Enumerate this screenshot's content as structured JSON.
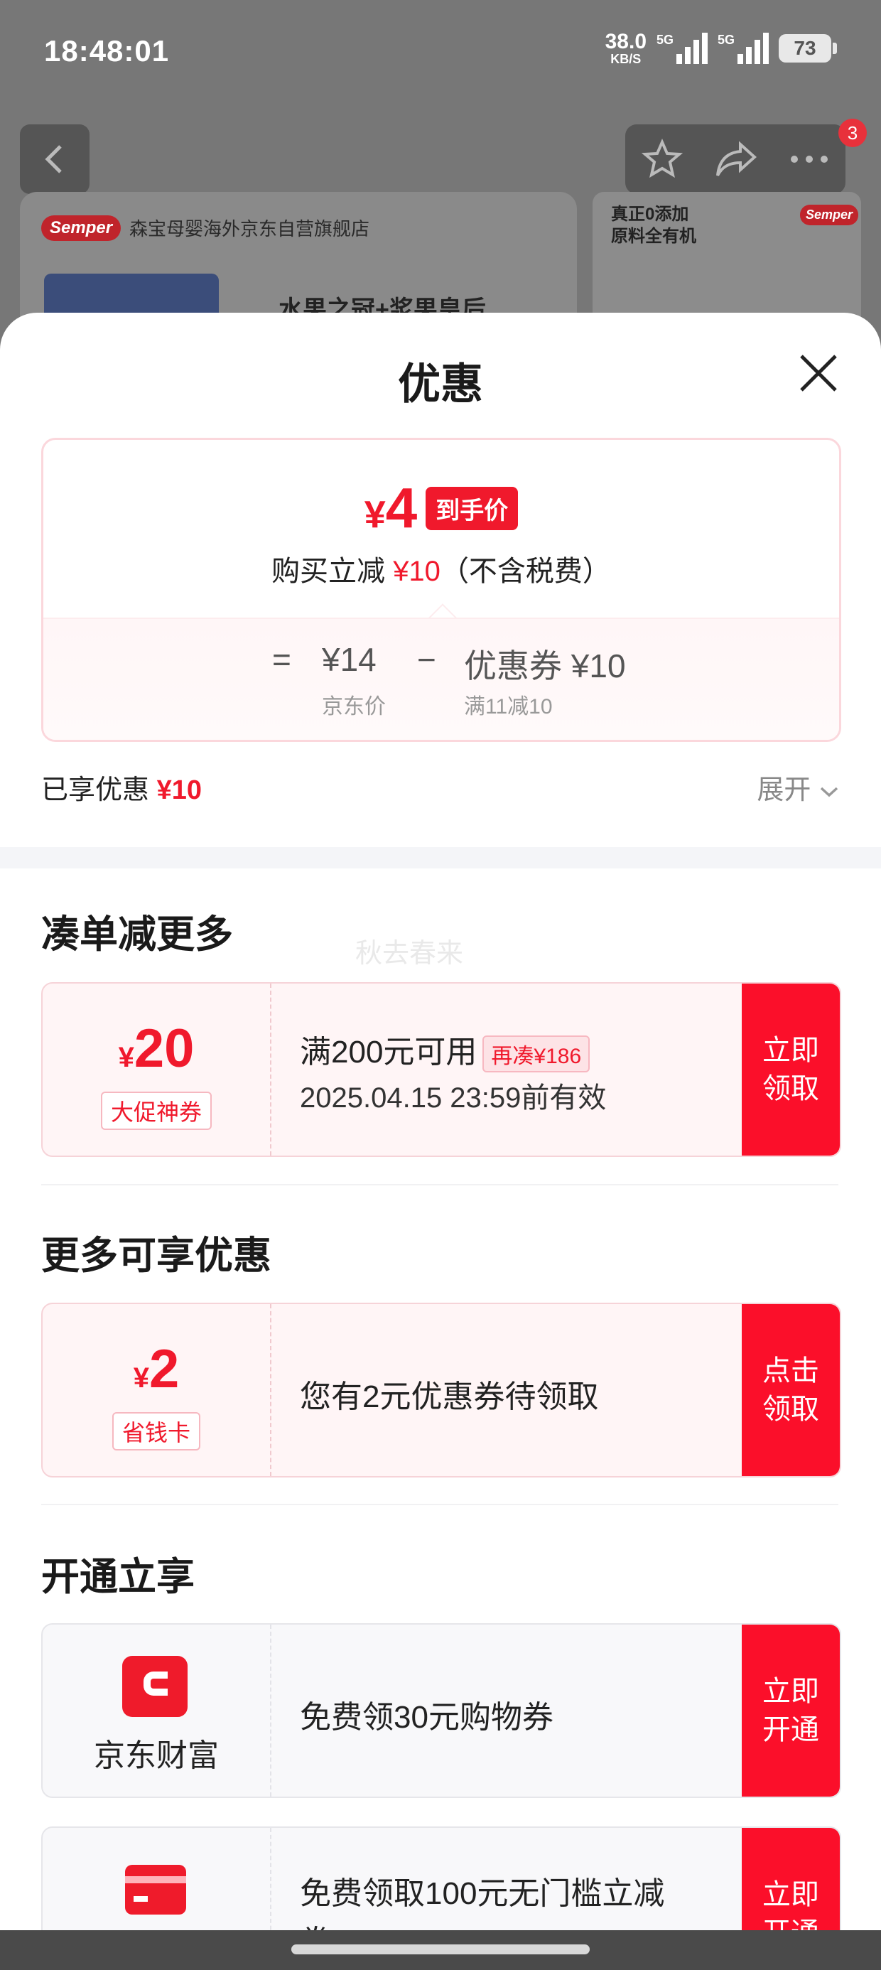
{
  "status_bar": {
    "time": "18:48:01",
    "net_speed": "38.0",
    "net_unit": "KB/S",
    "signal1_label": "5G",
    "signal2_label": "5G",
    "battery": "73"
  },
  "background": {
    "store_logo": "Semper",
    "store_name": "森宝母婴海外京东自营旗舰店",
    "headline": "水果之冠+浆果皇后",
    "side_text": "真正0添加\n原料全有机",
    "side_logo": "Semper",
    "cart_badge": "3"
  },
  "sheet": {
    "title": "优惠",
    "summary": {
      "currency": "¥",
      "final_price": "4",
      "final_tag": "到手价",
      "reduce_prefix": "购买立减",
      "reduce_amount": "¥10",
      "reduce_suffix": "（不含税费）",
      "eq": "=",
      "jd_price": "¥14",
      "jd_price_label": "京东价",
      "minus": "−",
      "coupon_label": "优惠券 ¥10",
      "coupon_rule": "满11减10"
    },
    "enjoyed_label": "已享优惠",
    "enjoyed_amount": "¥10",
    "expand_label": "展开",
    "section_more": "凑单减更多",
    "watermark": "秋去春来",
    "coupon1": {
      "currency": "¥",
      "amount": "20",
      "type": "大促神券",
      "condition": "满200元可用",
      "addon": "再凑¥186",
      "expiry": "2025.04.15 23:59前有效",
      "action_line1": "立即",
      "action_line2": "领取"
    },
    "section_enjoy": "更多可享优惠",
    "coupon2": {
      "currency": "¥",
      "amount": "2",
      "type": "省钱卡",
      "desc": "您有2元优惠券待领取",
      "action_line1": "点击",
      "action_line2": "领取"
    },
    "section_open": "开通立享",
    "coupon3": {
      "brand": "京东财富",
      "desc": "免费领30元购物券",
      "action_line1": "立即",
      "action_line2": "开通"
    },
    "coupon4": {
      "desc_line1": "免费领取100元无门槛立减",
      "desc_line2": "券",
      "action_line1": "立即",
      "action_line2": "开通"
    }
  },
  "colors": {
    "accent_red": "#f0192c",
    "action_red": "#fb0f2a"
  }
}
